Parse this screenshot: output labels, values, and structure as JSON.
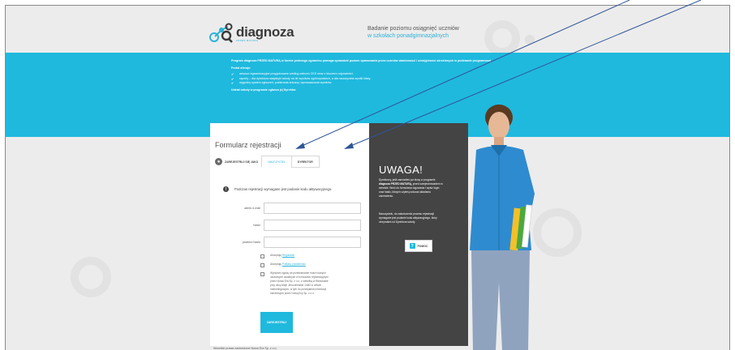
{
  "header": {
    "logo_text": "diagnoza",
    "logo_sub": "PRZED MATURĄ",
    "tagline_line1": "Badanie poziomu osiągnięć uczniów",
    "tagline_line2": "w szkołach ponadgimnazjalnych"
  },
  "band": {
    "intro": "Program diagnoza PRZED MATURĄ w formie próbnego egzaminu pomaga sprawdzić poziom opanowania przez uczniów wiadomości i umiejętności określonych w podstawie programowej.",
    "offer_title": "Portal oferuje:",
    "offer_items": [
      "arkusze egzaminacyjne przygotowane według zaleceń CKE wraz z kluczem odpowiedzi,",
      "raporty – dla dyrektora statystyki szkoły na tle wyników ogólnopolskich, a dla nauczyciela wyniki klasy,",
      "wygodny system zgłoszeń, pobierania arkuszy, wprowadzania wyników."
    ],
    "footer_line": "Udział szkoły w programie zgłasza jej Dyrektor."
  },
  "form": {
    "title": "Formularz rejestracji",
    "register_as_label": "ZAREJESTRUJ SIĘ JAKO",
    "tabs": [
      {
        "label": "NAUCZYCIEL",
        "active": true
      },
      {
        "label": "DYREKTOR",
        "active": false
      }
    ],
    "info_text": "Podczas rejestracji wymagane jest podanie kodu aktywacyjnego.",
    "fields": {
      "email_label": "adres e-mail",
      "password_label": "hasło",
      "repeat_label": "powtórz hasło"
    },
    "checks": {
      "regulamin_prefix": "Akceptuję",
      "regulamin_link": "Regulamin",
      "privacy_prefix": "Akceptuję",
      "privacy_link": "Politykę prywatności",
      "consent_text": "Wyrażam zgodę na przetwarzanie moich danych osobowych zawartych w formularzu rejestracyjnym przez Nowa Era Sp. z o.o. z siedzibą w Warszawie przy ulicy Aleje Jerozolimskie 146D w celach marketingowych, w tym do przesyłania informacji handlowych przez Nową Erę Sp. z o.o."
    },
    "submit_label": "ZAREJESTRUJ"
  },
  "notice": {
    "title": "UWAGA!",
    "p1_a": "Dyrektorzy, jeśli zamówiłeś już kiosy w programie",
    "p1_b": "diagnoza PRZED MATURĄ,",
    "p1_c": "przed zarejestrowaniem w serwisie. Wróć do formularza logowania i wpisz login oraz hasło, których użyłeś podczas składania zamówienia.",
    "p2": "Nauczycielu, do zakończenia procesu rejestracji wymagane jest podanie kodu aktywacyjnego, który otrzymałeś od Dyrektora szkoły.",
    "help_label": "POMOC"
  },
  "footer": {
    "text": "Wszelkie prawa zastrzeżone Nowa Era Sp. z o.o."
  },
  "colors": {
    "accent": "#1fb9de",
    "dark_panel": "#444444",
    "background": "#ececec"
  }
}
